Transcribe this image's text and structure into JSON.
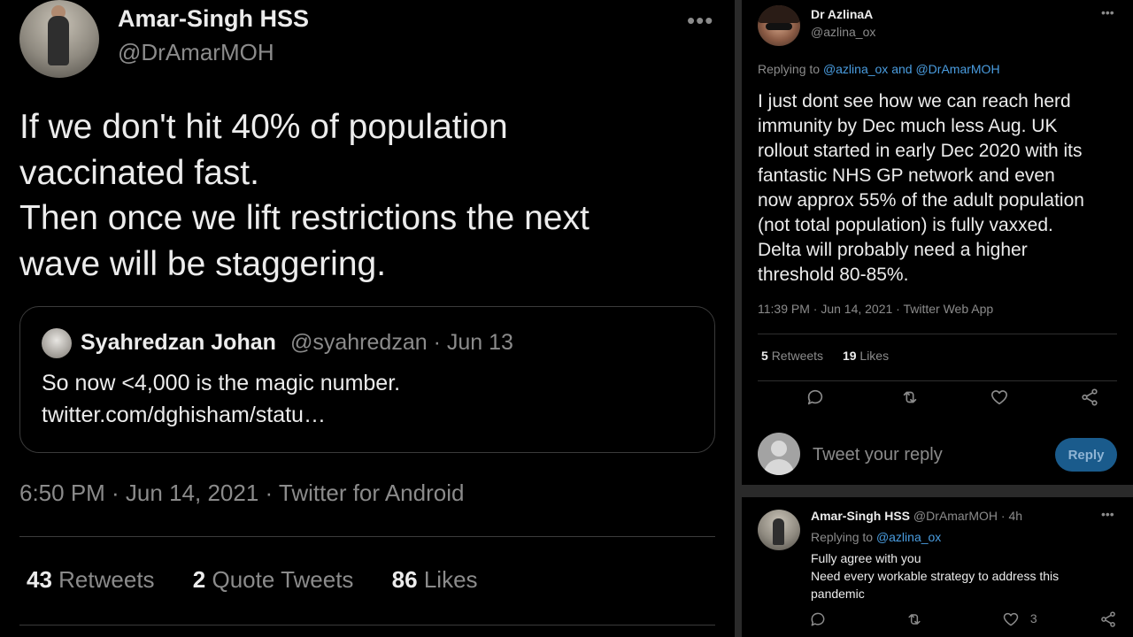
{
  "left_tweet": {
    "author_name": "Amar-Singh HSS",
    "author_handle": "@DrAmarMOH",
    "more": "•••",
    "text_lines": [
      "If we don't hit 40% of population",
      "vaccinated fast.",
      "Then once we lift restrictions the next",
      "wave will be staggering."
    ],
    "quote": {
      "author_name": "Syahredzan Johan",
      "meta": "@syahredzan · Jun 13",
      "text_lines": [
        "So now <4,000 is the magic number.",
        "twitter.com/dghisham/statu…"
      ]
    },
    "timestamp": "6:50 PM · Jun 14, 2021 · Twitter for Android",
    "stats": [
      {
        "count": "43",
        "label": "Retweets"
      },
      {
        "count": "2",
        "label": "Quote Tweets"
      },
      {
        "count": "86",
        "label": "Likes"
      }
    ]
  },
  "right_tweet": {
    "author_name": "Dr AzlinaA",
    "author_handle": "@azlina_ox",
    "more": "•••",
    "replying_prefix": "Replying to",
    "replying_to_1": "@azlina_ox",
    "replying_and": "and",
    "replying_to_2": "@DrAmarMOH",
    "text_lines": [
      "I just dont see how we can reach herd",
      "immunity by Dec much less Aug. UK",
      "rollout started in early Dec 2020 with its",
      "fantastic NHS GP network and even",
      "now approx 55% of the adult population",
      "(not total population) is fully vaxxed.",
      "Delta will probably need a higher",
      "threshold 80-85%."
    ],
    "timestamp": "11:39 PM · Jun 14, 2021 · Twitter Web App",
    "stats": [
      {
        "count": "5",
        "label": "Retweets"
      },
      {
        "count": "19",
        "label": "Likes"
      }
    ],
    "actions": [
      "reply-icon",
      "retweet-icon",
      "like-icon",
      "share-icon"
    ]
  },
  "reply_composer": {
    "placeholder": "Tweet your reply",
    "button_label": "Reply"
  },
  "reply": {
    "author_name": "Amar-Singh HSS",
    "meta": "@DrAmarMOH · 4h",
    "more": "•••",
    "replying_prefix": "Replying to",
    "replying_to": "@azlina_ox",
    "text_lines": [
      "Fully agree with you",
      "Need every workable strategy to address this",
      "pandemic"
    ],
    "like_count": "3"
  },
  "colors": {
    "background": "#000000",
    "text": "#ececec",
    "muted": "#8b8b8b",
    "link": "#4a9de0",
    "reply_button": "#1a5b8c"
  }
}
